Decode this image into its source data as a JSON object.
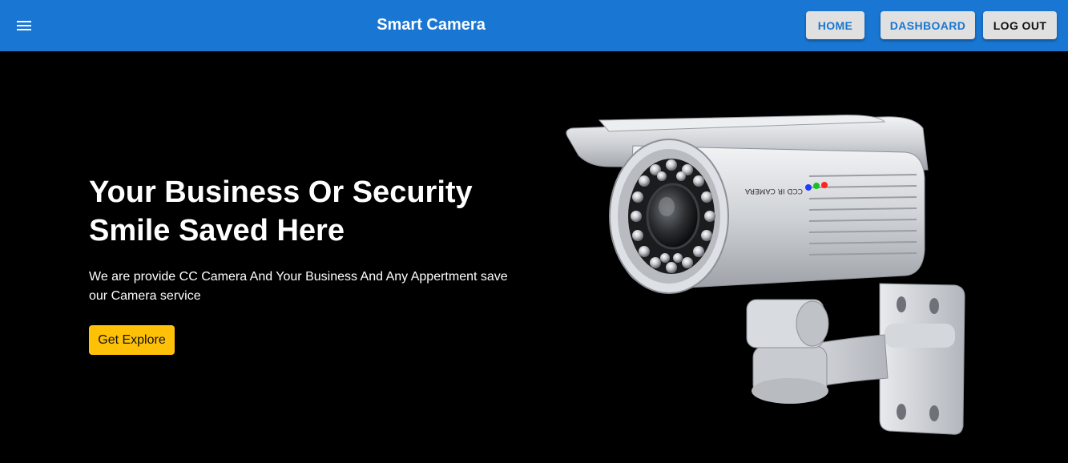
{
  "appbar": {
    "title": "Smart Camera",
    "menu_icon": "hamburger-menu-icon",
    "color": "#1976d2",
    "nav": {
      "home": "HOME",
      "dashboard": "DASHBOARD",
      "logout": "LOG OUT"
    }
  },
  "hero": {
    "headline_line1": "Your Business Or Security",
    "headline_line2": "Smile Saved Here",
    "description_line1": "We are provide CC Camera And Your Business And Any Appertment save",
    "description_line2": "our Camera service",
    "cta_label": "Get Explore",
    "cta_color": "#ffc107",
    "image": {
      "icon": "cctv-camera-image",
      "printed_label": "CCD IR CAMERA"
    }
  }
}
